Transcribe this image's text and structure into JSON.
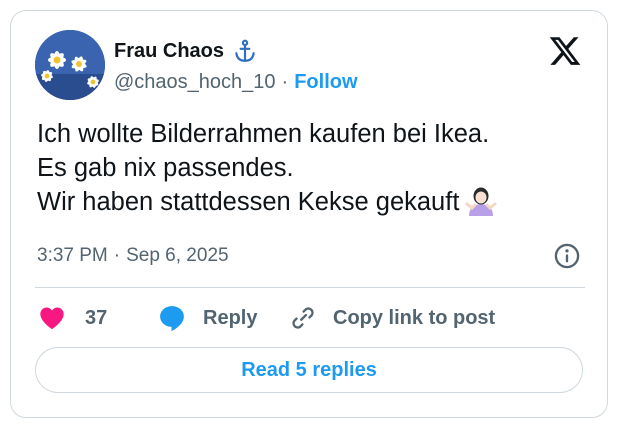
{
  "author": {
    "display_name": "Frau Chaos",
    "badge_icon": "anchor-icon",
    "handle": "@chaos_hoch_10",
    "separator": "·",
    "follow_label": "Follow",
    "avatar": "daisy-flowers-photo"
  },
  "platform_icon": "x-logo-icon",
  "tweet": {
    "lines": [
      "Ich wollte Bilderrahmen kaufen bei Ikea.",
      "Es gab nix passendes.",
      "Wir haben stattdessen Kekse gekauft"
    ],
    "trailing_emoji": "person-shrugging-emoji"
  },
  "meta": {
    "time": "3:37 PM",
    "separator": "·",
    "date": "Sep 6, 2025",
    "info_icon": "info-icon"
  },
  "actions": {
    "like_count": "37",
    "reply_label": "Reply",
    "copy_label": "Copy link to post"
  },
  "read_replies_label": "Read 5 replies",
  "colors": {
    "accent": "#1d9bf0",
    "like": "#f91880",
    "text": "#0f1419",
    "secondary": "#536471",
    "border": "#cfd9de"
  }
}
